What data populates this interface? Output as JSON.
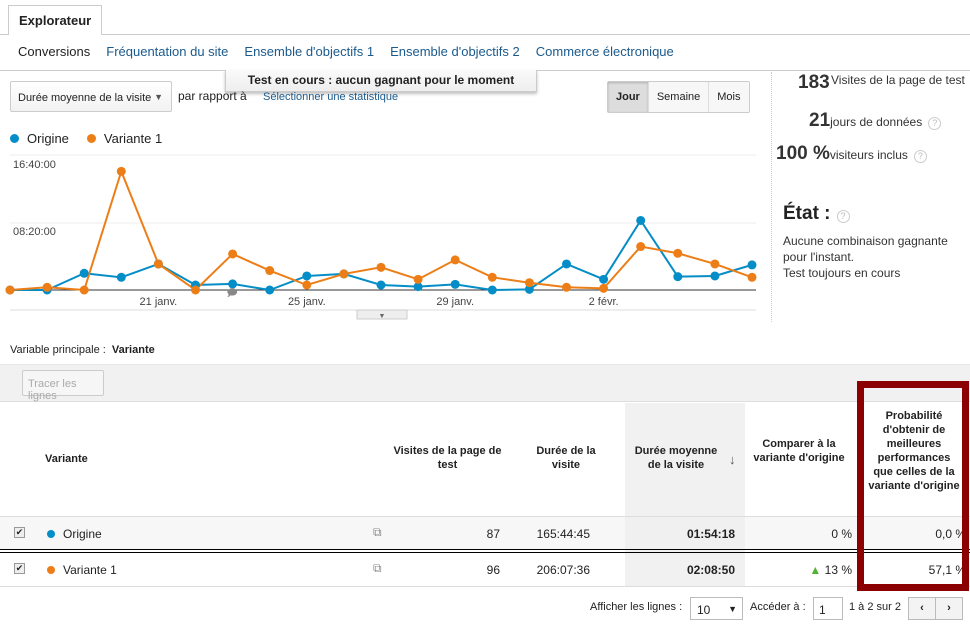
{
  "tab": "Explorateur",
  "subnav": [
    "Conversions",
    "Fréquentation du site",
    "Ensemble d'objectifs 1",
    "Ensemble d'objectifs 2",
    "Commerce électronique"
  ],
  "banner": "Test en cours : aucun gagnant pour le moment",
  "metric_select": "Durée moyenne de la visite",
  "compare_label": "par rapport à",
  "select_stat": "Sélectionner une statistique",
  "periods": [
    "Jour",
    "Semaine",
    "Mois"
  ],
  "legend": [
    "Origine",
    "Variante 1"
  ],
  "colors": {
    "origine": "#058dc7",
    "variante": "#ed7e17",
    "link": "#1a5a8c",
    "highlight": "#8b0000",
    "up": "#50b432"
  },
  "stats": [
    {
      "value": "183",
      "label": "Visites de la page de test"
    },
    {
      "value": "21",
      "label": "jours de données"
    },
    {
      "value": "100 %",
      "label": "visiteurs inclus"
    }
  ],
  "etat": {
    "title": "État :",
    "text1": "Aucune combinaison gagnante pour l'instant.",
    "text2": "Test toujours en cours"
  },
  "chart_data": {
    "type": "line",
    "x": [
      "17 janv.",
      "18 janv.",
      "19 janv.",
      "20 janv.",
      "21 janv.",
      "22 janv.",
      "23 janv.",
      "24 janv.",
      "25 janv.",
      "26 janv.",
      "27 janv.",
      "28 janv.",
      "29 janv.",
      "30 janv.",
      "31 janv.",
      "1 févr.",
      "2 févr.",
      "3 févr.",
      "4 févr.",
      "5 févr.",
      "6 févr."
    ],
    "x_tick_labels": [
      "21 janv.",
      "25 janv.",
      "29 janv.",
      "2 févr."
    ],
    "y_tick_labels": [
      "08:20:00",
      "16:40:00"
    ],
    "ylim": [
      "00:00:00",
      "16:40:00"
    ],
    "grid": true,
    "legend": "top-left",
    "series": [
      {
        "name": "Origine",
        "values": [
          "00:00:00",
          "00:00:00",
          "02:04:00",
          "01:34:00",
          "03:13:00",
          "00:37:00",
          "00:45:00",
          "00:00:00",
          "01:44:00",
          "01:59:00",
          "00:37:00",
          "00:25:00",
          "00:42:00",
          "00:00:00",
          "00:05:00",
          "03:13:00",
          "01:19:00",
          "08:35:00",
          "01:39:00",
          "01:44:00",
          "03:06:00"
        ]
      },
      {
        "name": "Variante 1",
        "values": [
          "00:00:00",
          "00:20:00",
          "00:00:00",
          "14:39:00",
          "03:13:00",
          "00:00:00",
          "04:27:00",
          "02:24:00",
          "00:37:00",
          "01:59:00",
          "02:48:00",
          "01:19:00",
          "03:43:00",
          "01:34:00",
          "00:54:00",
          "00:20:00",
          "00:12:00",
          "05:22:00",
          "04:32:00",
          "03:13:00",
          "01:34:00"
        ]
      }
    ]
  },
  "primary_var_label": "Variable principale :",
  "primary_var": "Variante",
  "tracer": "Tracer les lignes",
  "table": {
    "headers": [
      "Variante",
      "Visites de la page de test",
      "Durée de la visite",
      "Durée moyenne de la visite",
      "Comparer à la variante d'origine",
      "Probabilité d'obtenir de meilleures performances que celles de la variante d'origine"
    ],
    "rows": [
      {
        "name": "Origine",
        "visits": "87",
        "duration": "165:44:45",
        "avg": "01:54:18",
        "compare": "0 %",
        "prob": "0,0 %"
      },
      {
        "name": "Variante 1",
        "visits": "96",
        "duration": "206:07:36",
        "avg": "02:08:50",
        "compare": "13 %",
        "prob": "57,1 %"
      }
    ]
  },
  "pager": {
    "show_label": "Afficher les lignes :",
    "rows": "10",
    "goto_label": "Accéder à :",
    "page": "1",
    "range": "1 à 2 sur 2"
  }
}
